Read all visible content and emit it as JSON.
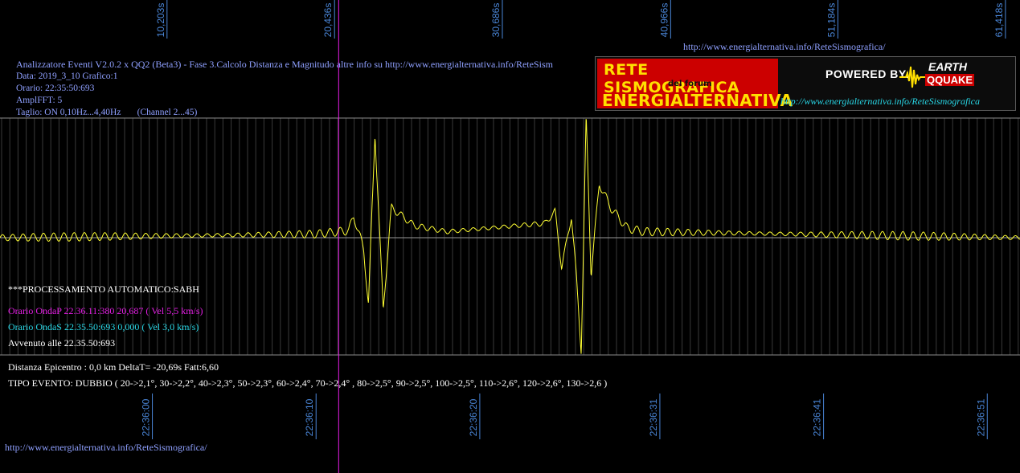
{
  "header": {
    "url_top": "http://www.energialternativa.info/ReteSismografica/",
    "line1": "Analizzatore Eventi V2.0.2 x QQ2 (Beta3) - Fase 3.Calcolo Distanza e Magnitudo altre info su http://www.energialternativa.info/ReteSism",
    "line2": "Data: 2019_3_10 Grafico:1",
    "line3": "Orario: 22:35:50:693",
    "line4": "AmplFFT: 5",
    "line5": "Taglio: ON 0,10Hz...4,40Hz       (Channel 2...45)"
  },
  "logo": {
    "line1": "RETE SISMOGRAFICA",
    "line2": "del forum",
    "line3": "ENERGIALTERNATIVA",
    "powered": "POWERED BY:",
    "earth": "EARTH",
    "quake": "QQUAKE",
    "url": "http://www.energialternativa.info/ReteSismografica"
  },
  "processing": {
    "title": "***PROCESSAMENTO AUTOMATICO:SABH",
    "onda_p": "Orario OndaP 22.36.11:380  20,687 ( Vel 5,5 km/s)",
    "onda_s": "Orario OndaS 22.35.50:693  0,000 ( Vel 3,0 km/s)",
    "avvenuto": "Avvenuto alle 22.35.50:693",
    "distanza": "Distanza Epicentro : 0,0 km DeltaT= -20,69s  Fatt:6,60",
    "tipo": "TIPO EVENTO: DUBBIO ( 20->2,1°, 30->2,2°, 40->2,3°, 50->2,3°, 60->2,4°, 70->2,4° , 80->2,5°, 90->2,5°, 100->2,5°, 110->2,6°, 120->2,6°, 130->2,6 )"
  },
  "footer": {
    "url": "http://www.energialternativa.info/ReteSismografica/"
  },
  "colors": {
    "background": "#000000",
    "trace": "#ffff33",
    "gridlines": "#3a3a3a",
    "tick_label": "#4a86d8",
    "p_wave_marker": "#e61ee6",
    "info_text": "#8fa0ff"
  },
  "chart_data": {
    "type": "line",
    "title": "",
    "xlabel": "",
    "ylabel": "",
    "seconds_ticks": [
      "10,203s",
      "20,436s",
      "30,686s",
      "40,966s",
      "51,184s",
      "61,418s"
    ],
    "time_ticks": [
      "22:36:00",
      "22:36:10",
      "22:36:20",
      "22:36:31",
      "22:36:41",
      "22:36:51"
    ],
    "xlim": [
      "22:35:50.693",
      "22:36:53.0"
    ],
    "ylim": [
      -1.0,
      1.0
    ],
    "grid": true,
    "p_wave_marker": "22:36:11.380",
    "series": [
      {
        "color": "#ffff33",
        "background_amplitude": 0.035,
        "x": [
          "22:35:50.7",
          "22:36:10.0",
          "22:36:11.4",
          "22:36:12.0",
          "22:36:12.3",
          "22:36:12.9",
          "22:36:13.2",
          "22:36:13.6",
          "22:36:14.1",
          "22:36:14.6",
          "22:36:16.0",
          "22:36:18.0",
          "22:36:24.0",
          "22:36:24.6",
          "22:36:25.0",
          "22:36:25.6",
          "22:36:25.9",
          "22:36:26.2",
          "22:36:26.5",
          "22:36:26.8",
          "22:36:27.3",
          "22:36:28.0",
          "22:36:29.0",
          "22:36:30.0",
          "22:36:53.0"
        ],
        "values": [
          0.0,
          0.03,
          0.05,
          0.06,
          0.18,
          -0.09,
          -0.55,
          0.87,
          -0.6,
          0.25,
          0.1,
          0.05,
          0.12,
          0.22,
          -0.25,
          0.18,
          -0.32,
          -0.95,
          1.0,
          -0.3,
          0.45,
          0.25,
          0.08,
          0.05,
          0.0
        ]
      }
    ]
  }
}
